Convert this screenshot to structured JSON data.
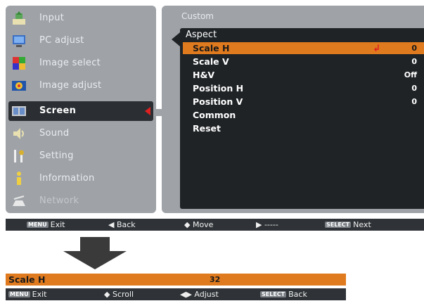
{
  "sidebar": {
    "items": [
      {
        "label": "Input",
        "icon": "input-icon"
      },
      {
        "label": "PC adjust",
        "icon": "pc-adjust-icon"
      },
      {
        "label": "Image select",
        "icon": "image-select-icon"
      },
      {
        "label": "Image adjust",
        "icon": "image-adjust-icon"
      },
      {
        "label": "Screen",
        "icon": "screen-icon",
        "selected": true
      },
      {
        "label": "Sound",
        "icon": "sound-icon"
      },
      {
        "label": "Setting",
        "icon": "setting-icon"
      },
      {
        "label": "Information",
        "icon": "information-icon"
      },
      {
        "label": "Network",
        "icon": "network-icon",
        "disabled": true
      }
    ]
  },
  "content": {
    "title": "Custom",
    "section": "Aspect",
    "rows": [
      {
        "label": "Scale H",
        "value": "0",
        "active": true
      },
      {
        "label": "Scale V",
        "value": "0"
      },
      {
        "label": "H&V",
        "value": "Off"
      },
      {
        "label": "Position H",
        "value": "0"
      },
      {
        "label": "Position V",
        "value": "0"
      },
      {
        "label": "Common",
        "value": ""
      },
      {
        "label": "Reset",
        "value": ""
      }
    ]
  },
  "guide": {
    "exit_key": "MENU",
    "exit": "Exit",
    "back": "◀ Back",
    "move": "◆ Move",
    "next_arrow": "▶ -----",
    "select_key": "SELECT",
    "next": "Next"
  },
  "popup": {
    "label": "Scale H",
    "value": "32",
    "guide": {
      "exit_key": "MENU",
      "exit": "Exit",
      "scroll": "◆ Scroll",
      "adjust": "◀▶ Adjust",
      "select_key": "SELECT",
      "back": "Back"
    }
  },
  "colors": {
    "panel_gray": "#9fa3a8",
    "dark_panel": "#1f2326",
    "highlight_orange": "#e07a1e",
    "selector_red": "#e02020",
    "guide_bar": "#2f3337"
  }
}
